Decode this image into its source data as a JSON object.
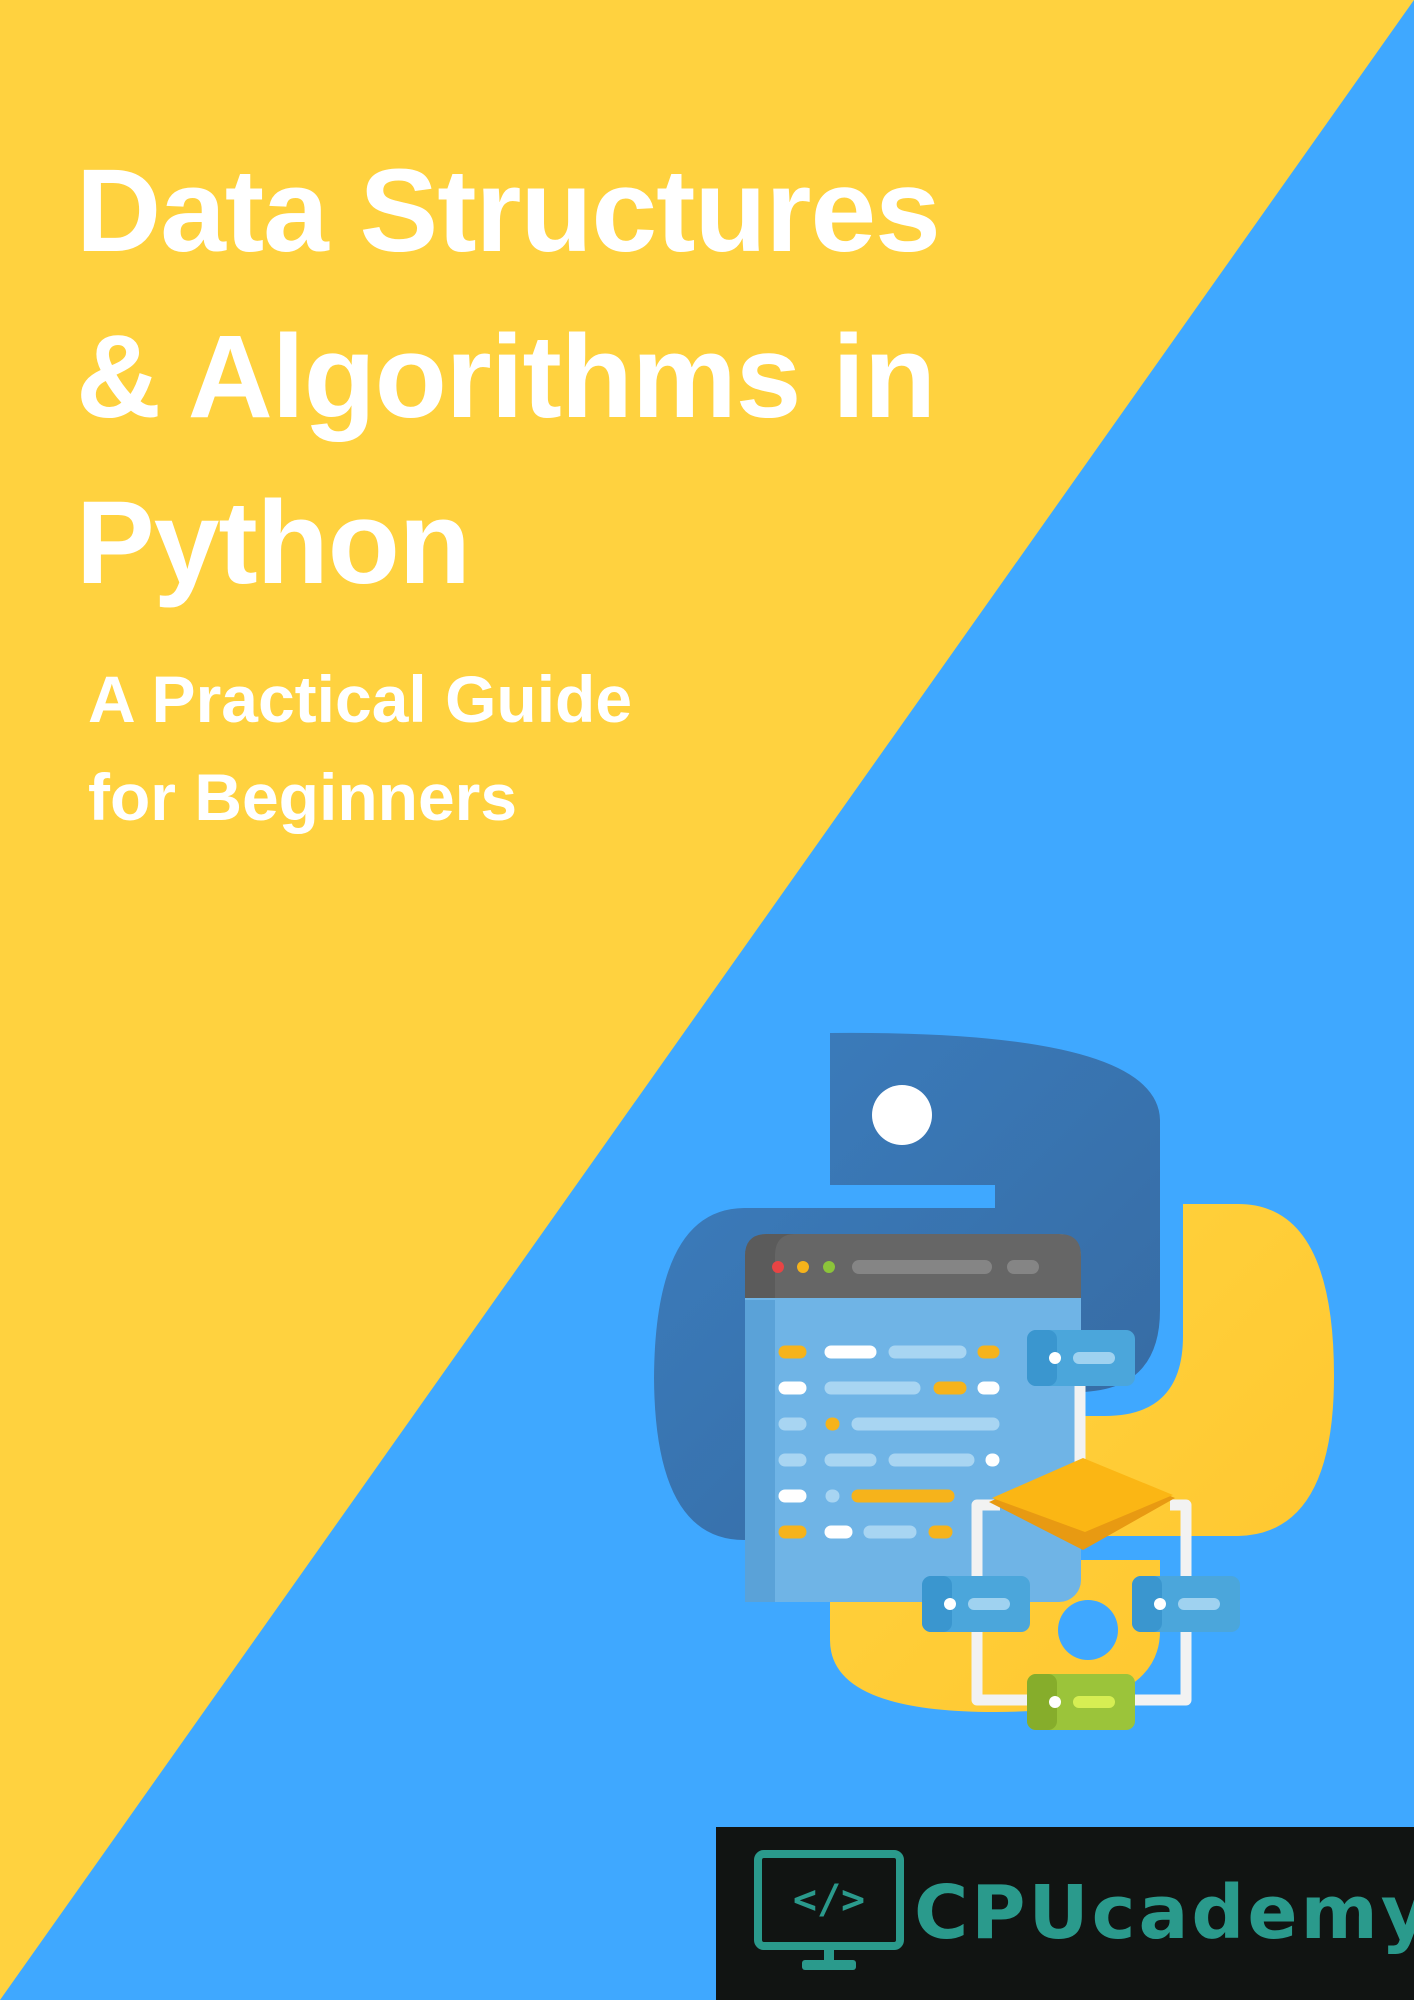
{
  "cover": {
    "title_lines": [
      "Data Structures",
      "& Algorithms in",
      "Python"
    ],
    "subtitle_lines": [
      "A Practical Guide",
      "for Beginners"
    ],
    "brand": {
      "name": "CPUcademy",
      "code_symbol": "</>",
      "logo_icon": "monitor-code-icon"
    },
    "illustration": {
      "icons": [
        "python-logo-icon",
        "code-editor-window-icon",
        "data-structure-graph-icon"
      ]
    }
  },
  "colors": {
    "yellow": "#FFD23F",
    "blue": "#3FA8FF",
    "white": "#FFFFFF",
    "brand_bar": "#111412",
    "brand_teal": "#2A9A8C"
  }
}
